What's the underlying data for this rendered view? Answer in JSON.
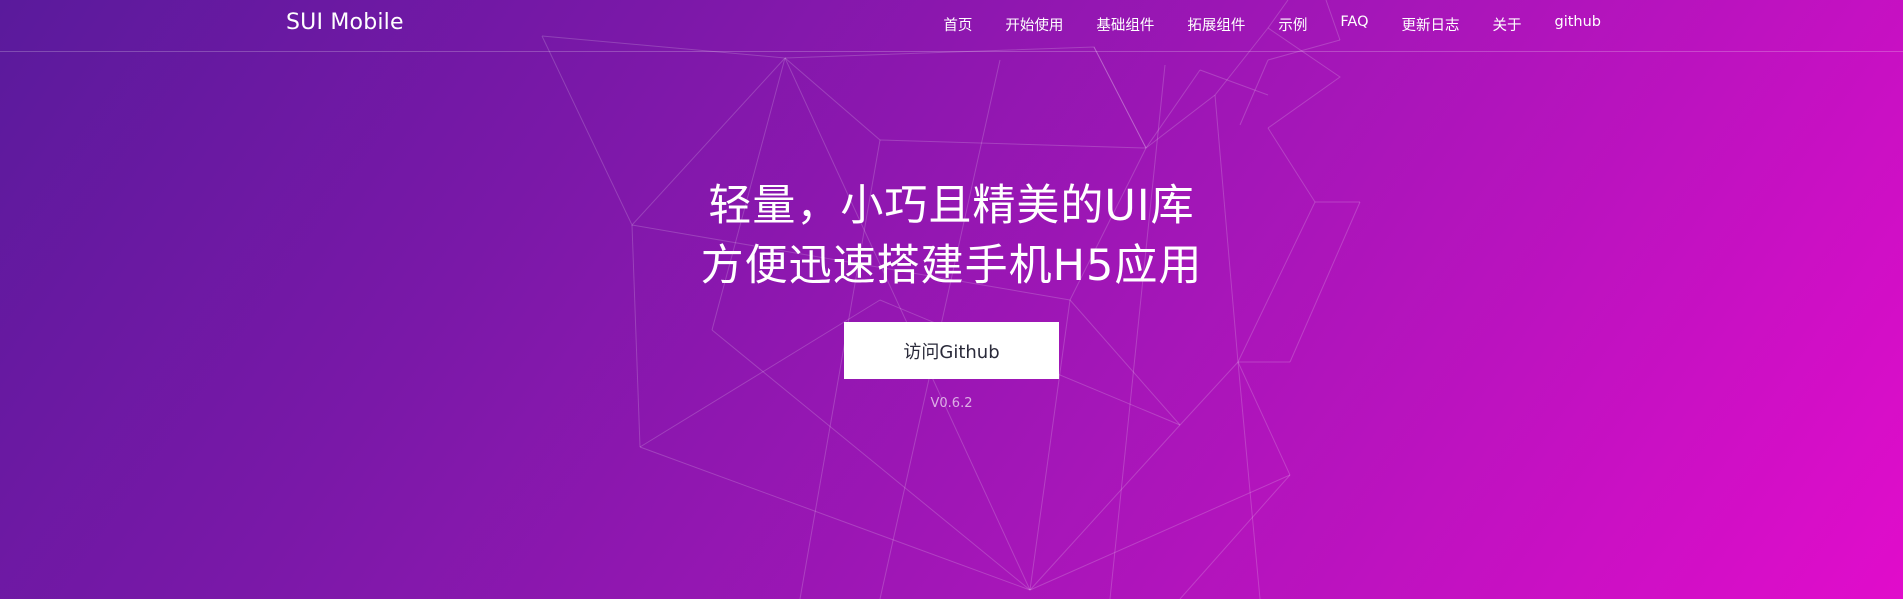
{
  "header": {
    "brand": "SUI Mobile",
    "nav": [
      {
        "label": "首页"
      },
      {
        "label": "开始使用"
      },
      {
        "label": "基础组件"
      },
      {
        "label": "拓展组件"
      },
      {
        "label": "示例"
      },
      {
        "label": "FAQ"
      },
      {
        "label": "更新日志"
      },
      {
        "label": "关于"
      },
      {
        "label": "github"
      }
    ]
  },
  "hero": {
    "line1": "轻量，小巧且精美的UI库",
    "line2": "方便迅速搭建手机H5应用",
    "button_label": "访问Github",
    "version": "V0.6.2"
  },
  "colors": {
    "gradient_start": "#5a1a9c",
    "gradient_end": "#e10ccb",
    "button_bg": "#ffffff"
  }
}
